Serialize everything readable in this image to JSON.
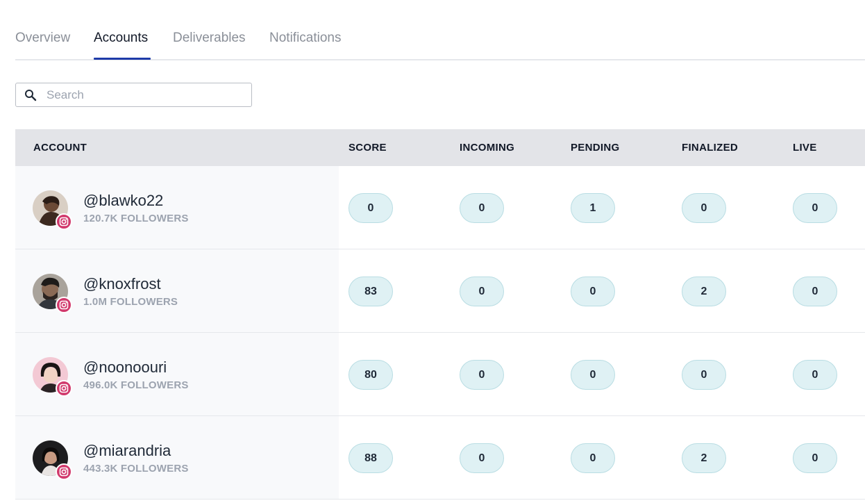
{
  "tabs": [
    {
      "label": "Overview",
      "active": false
    },
    {
      "label": "Accounts",
      "active": true
    },
    {
      "label": "Deliverables",
      "active": false
    },
    {
      "label": "Notifications",
      "active": false
    }
  ],
  "search": {
    "placeholder": "Search",
    "value": ""
  },
  "table": {
    "headers": {
      "account": "ACCOUNT",
      "score": "SCORE",
      "incoming": "INCOMING",
      "pending": "PENDING",
      "finalized": "FINALIZED",
      "live": "LIVE"
    },
    "rows": [
      {
        "handle": "@blawko22",
        "followers": "120.7K FOLLOWERS",
        "platform_icon": "instagram-icon",
        "score": "0",
        "incoming": "0",
        "pending": "1",
        "finalized": "0",
        "live": "0"
      },
      {
        "handle": "@knoxfrost",
        "followers": "1.0M FOLLOWERS",
        "platform_icon": "instagram-icon",
        "score": "83",
        "incoming": "0",
        "pending": "0",
        "finalized": "2",
        "live": "0"
      },
      {
        "handle": "@noonoouri",
        "followers": "496.0K FOLLOWERS",
        "platform_icon": "instagram-icon",
        "score": "80",
        "incoming": "0",
        "pending": "0",
        "finalized": "0",
        "live": "0"
      },
      {
        "handle": "@miarandria",
        "followers": "443.3K FOLLOWERS",
        "platform_icon": "instagram-icon",
        "score": "88",
        "incoming": "0",
        "pending": "0",
        "finalized": "2",
        "live": "0"
      }
    ]
  },
  "colors": {
    "accent": "#1e3ba8",
    "pill_bg": "#dff1f4",
    "instagram": "#d1396c",
    "header_bg": "#e3e4e8"
  }
}
